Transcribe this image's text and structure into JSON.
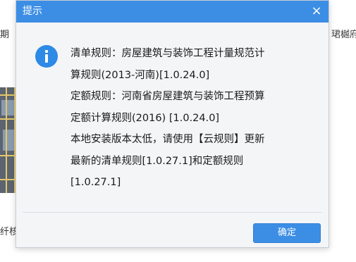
{
  "background": {
    "left_fragment_top": "期",
    "left_fragment_bottom": "纤核",
    "right_fragment_top": "珺樾府"
  },
  "dialog": {
    "title": "提示",
    "close_glyph": "×",
    "icon": "info-icon",
    "message_lines": [
      "清单规则：房屋建筑与装饰工程计量规范计",
      "算规则(2013-河南)[1.0.24.0]",
      "定额规则：河南省房屋建筑与装饰工程预算",
      "定额计算规则(2016) [1.0.24.0]",
      "本地安装版本太低，请使用【云规则】更新",
      "最新的清单规则[1.0.27.1]和定额规则",
      "[1.0.27.1]"
    ],
    "ok_label": "确定"
  },
  "colors": {
    "titlebar": "#3c8ee5",
    "button": "#3c8ee5",
    "info_icon": "#2d8ae6",
    "dialog_bg": "#f4f5f7"
  }
}
